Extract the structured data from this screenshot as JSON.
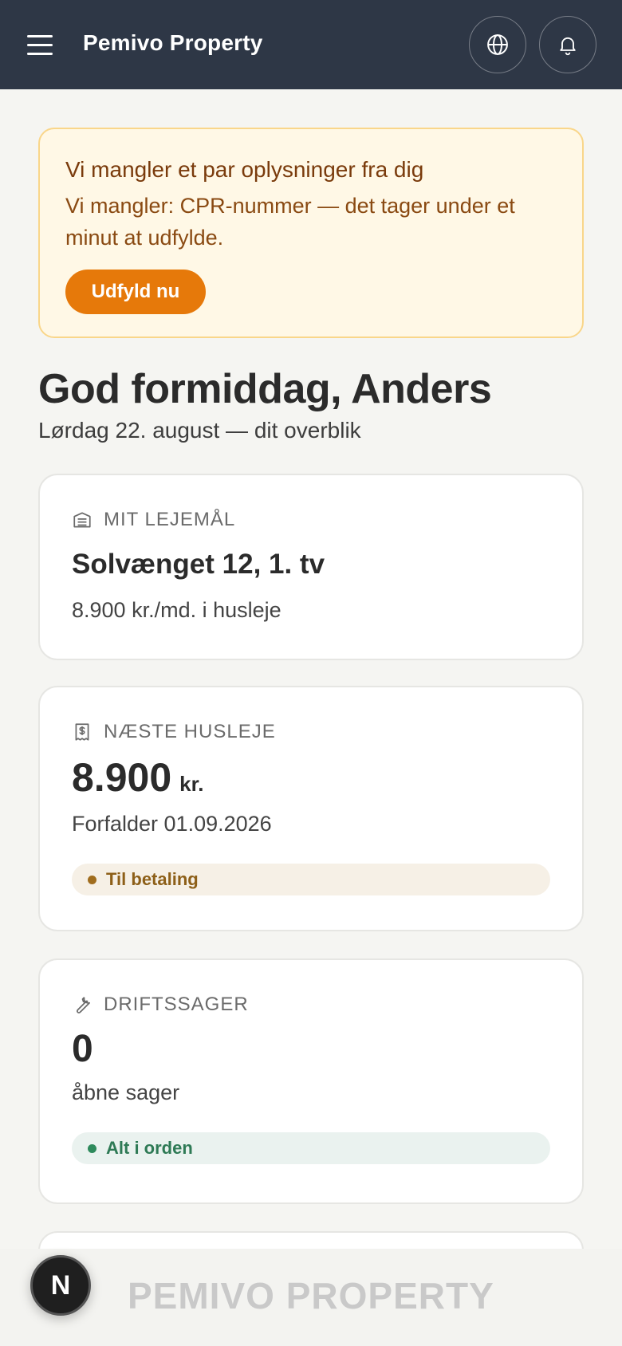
{
  "header": {
    "brand": "Pemivo Property",
    "icons": {
      "menu": "hamburger-icon",
      "language": "globe-icon",
      "notifications": "bell-icon"
    }
  },
  "notice": {
    "title": "Vi mangler et par oplysninger fra dig",
    "body": "Vi mangler: CPR-nummer — det tager under et minut at udfylde.",
    "button_label": "Udfyld nu",
    "colors": {
      "background": "#fff8e6",
      "border": "#f9d68a",
      "button": "#e6790a"
    }
  },
  "greeting": {
    "title": "God formiddag, Anders",
    "subtitle": "Lørdag 22. august — dit overblik"
  },
  "cards": {
    "lease": {
      "icon": "building-icon",
      "label": "MIT LEJEMÅL",
      "address": "Solvænget 12, 1. tv",
      "rent_text": "8.900 kr./md. i husleje"
    },
    "next_rent": {
      "icon": "receipt-dollar-icon",
      "label": "NÆSTE HUSLEJE",
      "amount": "8.900",
      "unit": "kr.",
      "due_text": "Forfalder 01.09.2026",
      "status": "Til betaling"
    },
    "maintenance": {
      "icon": "wrench-icon",
      "label": "DRIFTSSAGER",
      "count": "0",
      "count_text": "åbne sager",
      "status": "Alt i orden"
    }
  },
  "footer": {
    "brand_watermark": "PEMIVO PROPERTY",
    "badge_letter": "N"
  }
}
